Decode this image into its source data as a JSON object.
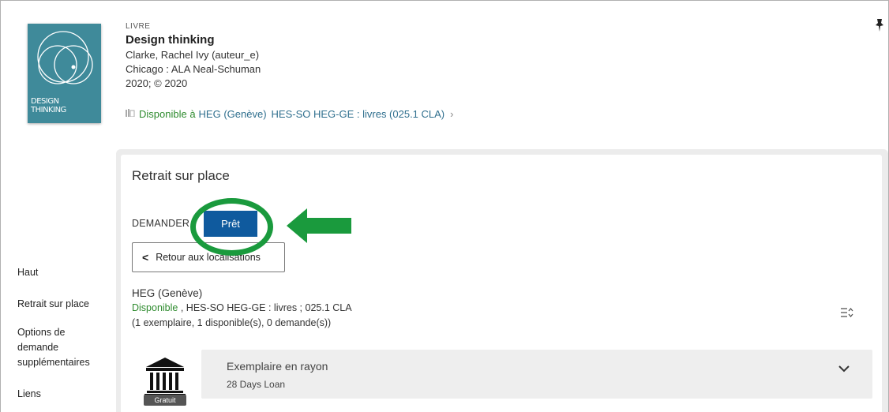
{
  "record": {
    "type": "LIVRE",
    "title": "Design thinking",
    "author": "Clarke, Rachel Ivy (auteur_e)",
    "publisher": "Chicago : ALA Neal-Schuman",
    "date": "2020; © 2020",
    "cover_text": [
      "DESIGN",
      "THINKING"
    ],
    "availability": {
      "status": "Disponible à",
      "library": "HEG (Genève)",
      "location": "HES-SO HEG-GE : livres (025.1 CLA)"
    }
  },
  "leftnav": {
    "items": [
      {
        "label": "Haut"
      },
      {
        "label": "Retrait sur place"
      },
      {
        "label": "Options de"
      },
      {
        "label": "demande"
      },
      {
        "label": "supplémentaires"
      },
      {
        "label": "Liens"
      }
    ]
  },
  "panel": {
    "title": "Retrait sur place",
    "request_label": "DEMANDER",
    "pret_button": "Prêt",
    "back_button": "Retour aux localisations",
    "location": {
      "name": "HEG (Genève)",
      "status": "Disponible",
      "detail": " , HES-SO HEG-GE : livres ; 025.1 CLA",
      "counts": "(1 exemplaire, 1 disponible(s), 0 demande(s))"
    },
    "item": {
      "title": "Exemplaire en rayon",
      "policy": "28 Days Loan",
      "badge": "Gratuit"
    }
  },
  "colors": {
    "primary_button": "#0f5a9e",
    "available_green": "#2e8b2e",
    "link_blue": "#2f6f8e",
    "annotation_green": "#1a9a3d",
    "cover_teal": "#3f8a9a"
  },
  "icons": {
    "pin": "pin-icon",
    "library": "library-building-icon",
    "sort": "sort-icon",
    "expand": "chevron-down-icon",
    "back": "chevron-left-icon",
    "availability": "book-icon"
  }
}
